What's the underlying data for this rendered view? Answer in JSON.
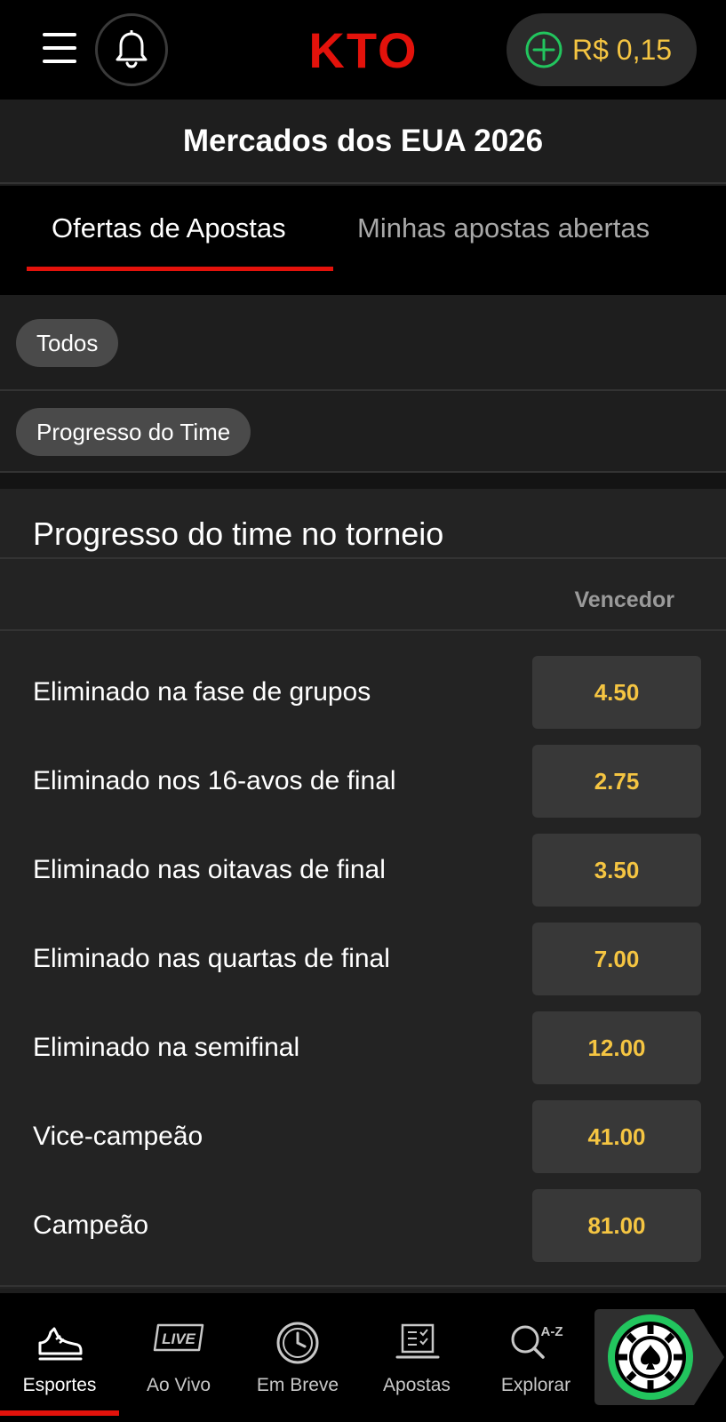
{
  "header": {
    "logo_text": "KTO",
    "balance": "R$ 0,15",
    "brand_color": "#e3120b",
    "accent_gold": "#f5c542",
    "plus_green": "#22c55e"
  },
  "page": {
    "title": "Mercados dos EUA 2026"
  },
  "tabs": [
    {
      "label": "Ofertas de Apostas",
      "active": true
    },
    {
      "label": "Minhas apostas abertas",
      "active": false
    }
  ],
  "filters": [
    {
      "label": "Todos"
    },
    {
      "label": "Progresso do Time"
    }
  ],
  "market": {
    "title": "Progresso do time no torneio",
    "column_header": "Vencedor",
    "outcomes": [
      {
        "label": "Eliminado na fase de grupos",
        "odds": "4.50"
      },
      {
        "label": "Eliminado nos 16-avos de final",
        "odds": "2.75"
      },
      {
        "label": "Eliminado nas oitavas de final",
        "odds": "3.50"
      },
      {
        "label": "Eliminado nas quartas de final",
        "odds": "7.00"
      },
      {
        "label": "Eliminado na semifinal",
        "odds": "12.00"
      },
      {
        "label": "Vice-campeão",
        "odds": "41.00"
      },
      {
        "label": "Campeão",
        "odds": "81.00"
      }
    ]
  },
  "bottom_nav": {
    "items": [
      {
        "label": "Esportes",
        "icon": "sneaker-icon",
        "active": true
      },
      {
        "label": "Ao Vivo",
        "icon": "live-icon",
        "active": false
      },
      {
        "label": "Em Breve",
        "icon": "clock-icon",
        "active": false
      },
      {
        "label": "Apostas",
        "icon": "betslip-icon",
        "active": false
      },
      {
        "label": "Explorar",
        "icon": "search-az-icon",
        "active": false
      }
    ],
    "live_badge": "LIVE",
    "az_text": "A-Z",
    "casino_icon": "casino-chip-icon"
  }
}
